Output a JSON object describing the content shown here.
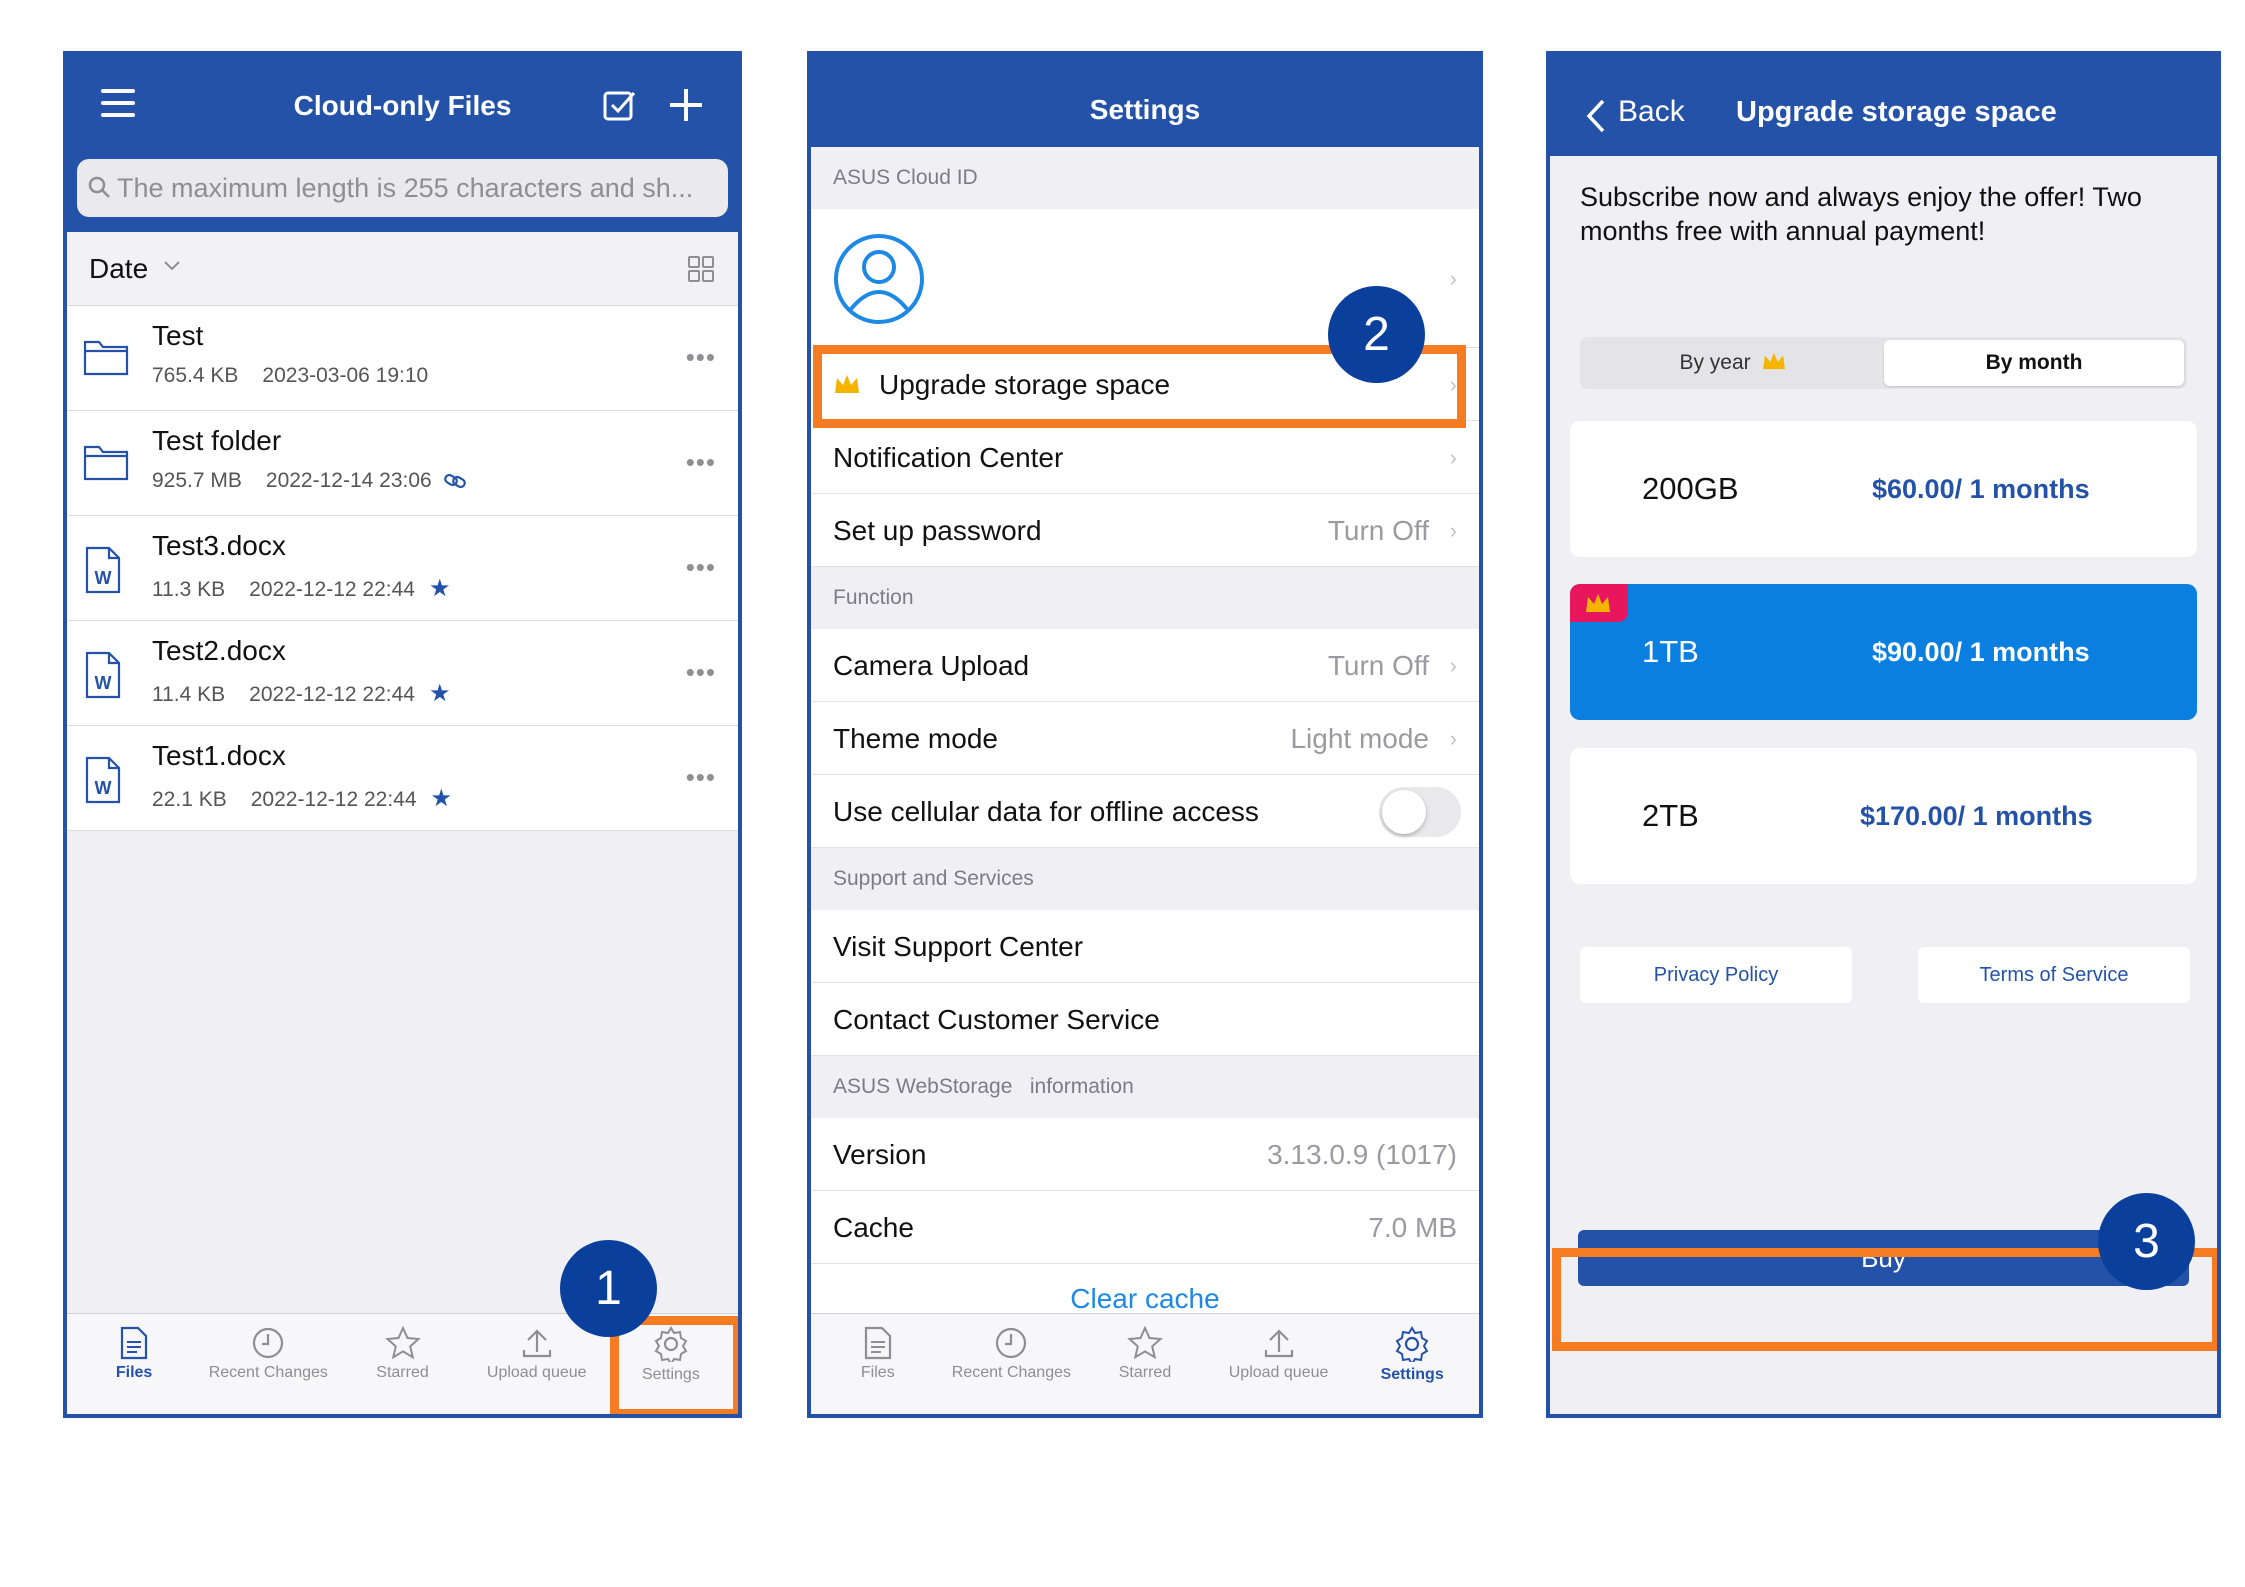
{
  "panel1": {
    "title": "Cloud-only Files",
    "search_placeholder": "The maximum length is 255 characters and sh...",
    "sort_label": "Date",
    "files": [
      {
        "name": "Test",
        "size": "765.4 KB",
        "date": "2023-03-06 19:10",
        "type": "folder",
        "badge": ""
      },
      {
        "name": "Test folder",
        "size": "925.7 MB",
        "date": "2022-12-14 23:06",
        "type": "folder",
        "badge": "link-icon"
      },
      {
        "name": "Test3.docx",
        "size": "11.3 KB",
        "date": "2022-12-12 22:44",
        "type": "docx",
        "badge": "star-icon"
      },
      {
        "name": "Test2.docx",
        "size": "11.4 KB",
        "date": "2022-12-12 22:44",
        "type": "docx",
        "badge": "star-icon"
      },
      {
        "name": "Test1.docx",
        "size": "22.1 KB",
        "date": "2022-12-12 22:44",
        "type": "docx",
        "badge": "star-icon"
      }
    ],
    "active_tab": "Files",
    "callout": "1"
  },
  "tabs": [
    "Files",
    "Recent Changes",
    "Starred",
    "Upload queue",
    "Settings"
  ],
  "panel2": {
    "title": "Settings",
    "section_cloud": "ASUS Cloud ID",
    "upgrade_label": "Upgrade storage space",
    "notification_label": "Notification Center",
    "password_label": "Set up password",
    "password_value": "Turn Off",
    "section_function": "Function",
    "camera_label": "Camera Upload",
    "camera_value": "Turn Off",
    "theme_label": "Theme mode",
    "theme_value": "Light mode",
    "cellular_label": "Use cellular data for offline access",
    "section_support": "Support and Services",
    "support_label": "Visit Support Center",
    "contact_label": "Contact Customer Service",
    "section_info": "ASUS WebStorage   information",
    "version_label": "Version",
    "version_value": "3.13.0.9 (1017)",
    "cache_label": "Cache",
    "cache_value": "7.0 MB",
    "clear_cache": "Clear cache",
    "active_tab": "Settings",
    "callout": "2"
  },
  "panel3": {
    "back_label": "Back",
    "title": "Upgrade storage space",
    "promo": "Subscribe now and always enjoy the offer! Two months free with annual payment!",
    "seg_year": "By year",
    "seg_month": "By month",
    "plans": [
      {
        "size": "200GB",
        "price": "$60.00/ 1 months"
      },
      {
        "size": "1TB",
        "price": "$90.00/ 1 months"
      },
      {
        "size": "2TB",
        "price": "$170.00/ 1 months"
      }
    ],
    "privacy": "Privacy Policy",
    "terms": "Terms of Service",
    "buy": "Buy",
    "callout": "3"
  },
  "colors": {
    "brand": "#2452a9",
    "highlight": "#f57c22",
    "selected_plan": "#0a7fe0",
    "callout": "#0b3f9c"
  }
}
